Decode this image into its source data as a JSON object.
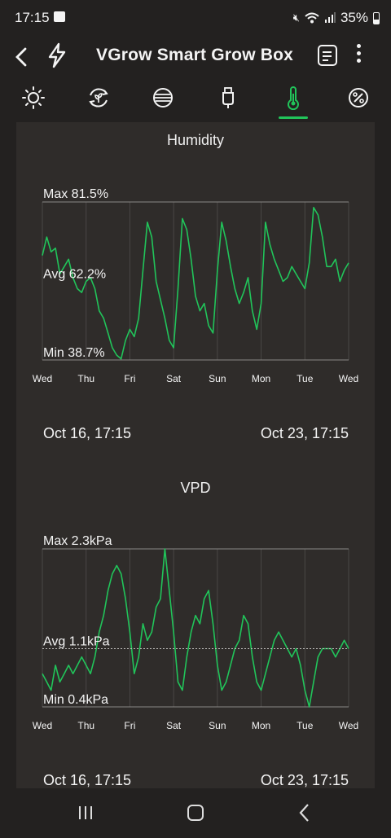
{
  "status_bar": {
    "time": "17:15",
    "battery": "35%"
  },
  "app_bar": {
    "back_icon": "chevron-left-icon",
    "title": "VGrow Smart Grow Box"
  },
  "tabs": [
    {
      "icon": "sun-icon",
      "active": false
    },
    {
      "icon": "leaf-cycle-icon",
      "active": false
    },
    {
      "icon": "fan-icon",
      "active": false
    },
    {
      "icon": "usb-plug-icon",
      "active": false
    },
    {
      "icon": "thermometer-icon",
      "active": true
    },
    {
      "icon": "percent-icon",
      "active": false
    }
  ],
  "accent_color": "#21c45a",
  "humidity": {
    "title": "Humidity",
    "max_label": "Max 81.5%",
    "avg_label": "Avg 62.2%",
    "min_label": "Min 38.7%",
    "start_label": "Oct 16, 17:15",
    "end_label": "Oct 23, 17:15"
  },
  "vpd": {
    "title": "VPD",
    "max_label": "Max 2.3kPa",
    "avg_label": "Avg 1.1kPa",
    "min_label": "Min 0.4kPa",
    "start_label": "Oct 16, 17:15",
    "end_label": "Oct 23, 17:15"
  },
  "chart_data": [
    {
      "type": "line",
      "title": "Humidity",
      "x_ticks": [
        "Wed",
        "Thu",
        "Fri",
        "Sat",
        "Sun",
        "Mon",
        "Tue",
        "Wed"
      ],
      "ylim": [
        38.7,
        81.5
      ],
      "series": [
        {
          "color": "#21c45a",
          "x": [
            0,
            0.1,
            0.2,
            0.3,
            0.4,
            0.5,
            0.6,
            0.7,
            0.8,
            0.9,
            1.0,
            1.1,
            1.2,
            1.3,
            1.4,
            1.5,
            1.6,
            1.7,
            1.8,
            1.9,
            2.0,
            2.1,
            2.2,
            2.3,
            2.4,
            2.5,
            2.6,
            2.7,
            2.8,
            2.9,
            3.0,
            3.1,
            3.2,
            3.3,
            3.4,
            3.5,
            3.6,
            3.7,
            3.8,
            3.9,
            4.0,
            4.1,
            4.2,
            4.3,
            4.4,
            4.5,
            4.6,
            4.7,
            4.8,
            4.9,
            5.0,
            5.1,
            5.2,
            5.3,
            5.4,
            5.5,
            5.6,
            5.7,
            5.8,
            5.9,
            6.0,
            6.1,
            6.2,
            6.3,
            6.4,
            6.5,
            6.6,
            6.7,
            6.8,
            6.9,
            7.0
          ],
          "values": [
            67,
            72,
            68,
            69,
            62,
            64,
            66,
            61,
            58,
            57,
            60,
            61,
            58,
            52,
            50,
            46,
            42,
            40,
            39,
            44,
            47,
            45,
            50,
            63,
            76,
            72,
            60,
            55,
            50,
            44,
            42,
            58,
            77,
            74,
            66,
            56,
            52,
            54,
            48,
            46,
            63,
            76,
            71,
            64,
            58,
            54,
            57,
            61,
            52,
            47,
            54,
            76,
            70,
            66,
            63,
            60,
            61,
            64,
            62,
            60,
            58,
            65,
            80,
            78,
            72,
            64,
            64,
            66,
            60,
            63,
            65
          ]
        }
      ]
    },
    {
      "type": "line",
      "title": "VPD",
      "x_ticks": [
        "Wed",
        "Thu",
        "Fri",
        "Sat",
        "Sun",
        "Mon",
        "Tue",
        "Wed"
      ],
      "ylim": [
        0.4,
        2.3
      ],
      "series": [
        {
          "color": "#21c45a",
          "x": [
            0,
            0.1,
            0.2,
            0.3,
            0.4,
            0.5,
            0.6,
            0.7,
            0.8,
            0.9,
            1.0,
            1.1,
            1.2,
            1.3,
            1.4,
            1.5,
            1.6,
            1.7,
            1.8,
            1.9,
            2.0,
            2.1,
            2.2,
            2.3,
            2.4,
            2.5,
            2.6,
            2.7,
            2.8,
            2.9,
            3.0,
            3.1,
            3.2,
            3.3,
            3.4,
            3.5,
            3.6,
            3.7,
            3.8,
            3.9,
            4.0,
            4.1,
            4.2,
            4.3,
            4.4,
            4.5,
            4.6,
            4.7,
            4.8,
            4.9,
            5.0,
            5.1,
            5.2,
            5.3,
            5.4,
            5.5,
            5.6,
            5.7,
            5.8,
            5.9,
            6.0,
            6.1,
            6.2,
            6.3,
            6.4,
            6.5,
            6.6,
            6.7,
            6.8,
            6.9,
            7.0
          ],
          "values": [
            0.8,
            0.7,
            0.6,
            0.9,
            0.7,
            0.8,
            0.9,
            0.8,
            0.9,
            1.0,
            0.9,
            0.8,
            1.0,
            1.3,
            1.5,
            1.8,
            2.0,
            2.1,
            2.0,
            1.7,
            1.3,
            0.8,
            1.0,
            1.4,
            1.2,
            1.3,
            1.6,
            1.7,
            2.3,
            1.8,
            1.3,
            0.7,
            0.6,
            1.0,
            1.3,
            1.5,
            1.4,
            1.7,
            1.8,
            1.4,
            0.9,
            0.6,
            0.7,
            0.9,
            1.1,
            1.2,
            1.5,
            1.4,
            1.0,
            0.7,
            0.6,
            0.8,
            1.0,
            1.2,
            1.3,
            1.2,
            1.1,
            1.0,
            1.1,
            0.9,
            0.6,
            0.4,
            0.7,
            1.0,
            1.1,
            1.1,
            1.1,
            1.0,
            1.1,
            1.2,
            1.1
          ]
        }
      ]
    }
  ]
}
